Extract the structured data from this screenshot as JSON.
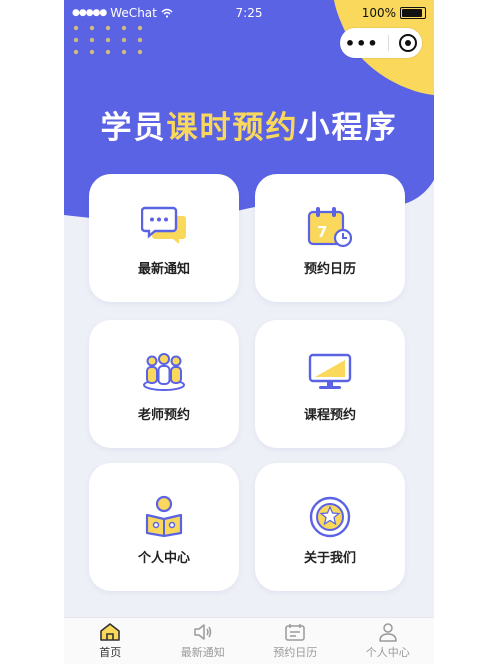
{
  "status": {
    "carrier": "WeChat",
    "time": "7:25",
    "battery": "100%"
  },
  "header": {
    "title_prefix": "学员",
    "title_highlight": "课时预约",
    "title_suffix": "小程序"
  },
  "colors": {
    "primary": "#5b63e5",
    "accent": "#f9d85b",
    "background": "#eef0f7"
  },
  "menu": [
    {
      "label": "最新通知",
      "icon": "message-icon"
    },
    {
      "label": "预约日历",
      "icon": "calendar-icon"
    },
    {
      "label": "老师预约",
      "icon": "teachers-icon"
    },
    {
      "label": "课程预约",
      "icon": "monitor-icon"
    },
    {
      "label": "个人中心",
      "icon": "person-reading-icon"
    },
    {
      "label": "关于我们",
      "icon": "badge-icon"
    }
  ],
  "tabbar": [
    {
      "label": "首页",
      "icon": "home-icon",
      "active": true
    },
    {
      "label": "最新通知",
      "icon": "speaker-icon"
    },
    {
      "label": "预约日历",
      "icon": "calendar-tab-icon"
    },
    {
      "label": "个人中心",
      "icon": "user-icon"
    }
  ]
}
